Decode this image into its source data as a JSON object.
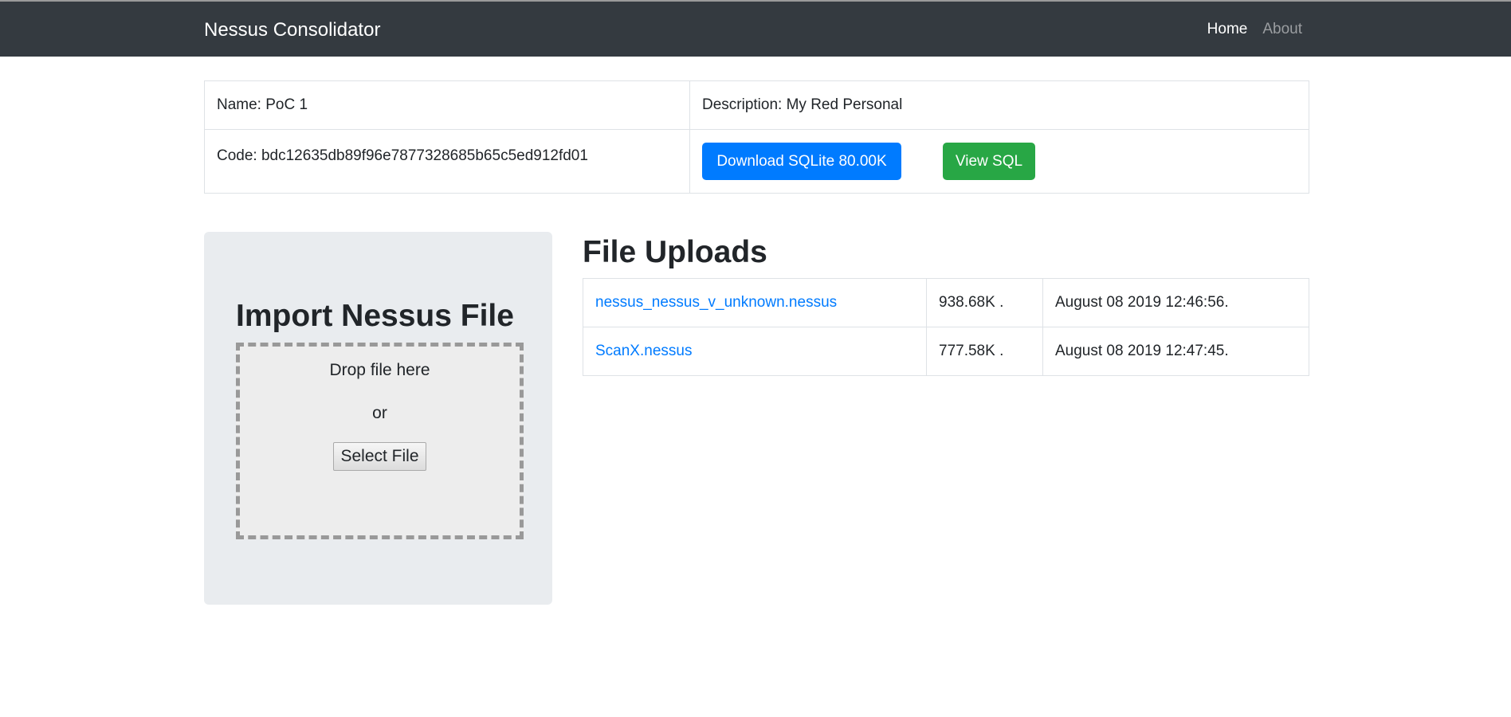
{
  "navbar": {
    "brand": "Nessus Consolidator",
    "links": [
      {
        "label": "Home"
      },
      {
        "label": "About"
      }
    ]
  },
  "project": {
    "name": "Name: PoC 1",
    "description": "Description: My Red Personal",
    "code": "Code: bdc12635db89f96e7877328685b65c5ed912fd01",
    "download_label": "Download SQLite 80.00K",
    "view_sql_label": "View SQL"
  },
  "import": {
    "title": "Import Nessus File",
    "drop_text": "Drop file here",
    "or_text": "or",
    "select_label": "Select File"
  },
  "uploads": {
    "title": "File Uploads",
    "rows": [
      {
        "name": "nessus_nessus_v_unknown.nessus",
        "size": "938.68K .",
        "date": "August 08 2019 12:46:56."
      },
      {
        "name": "ScanX.nessus",
        "size": "777.58K .",
        "date": "August 08 2019 12:47:45."
      }
    ]
  }
}
